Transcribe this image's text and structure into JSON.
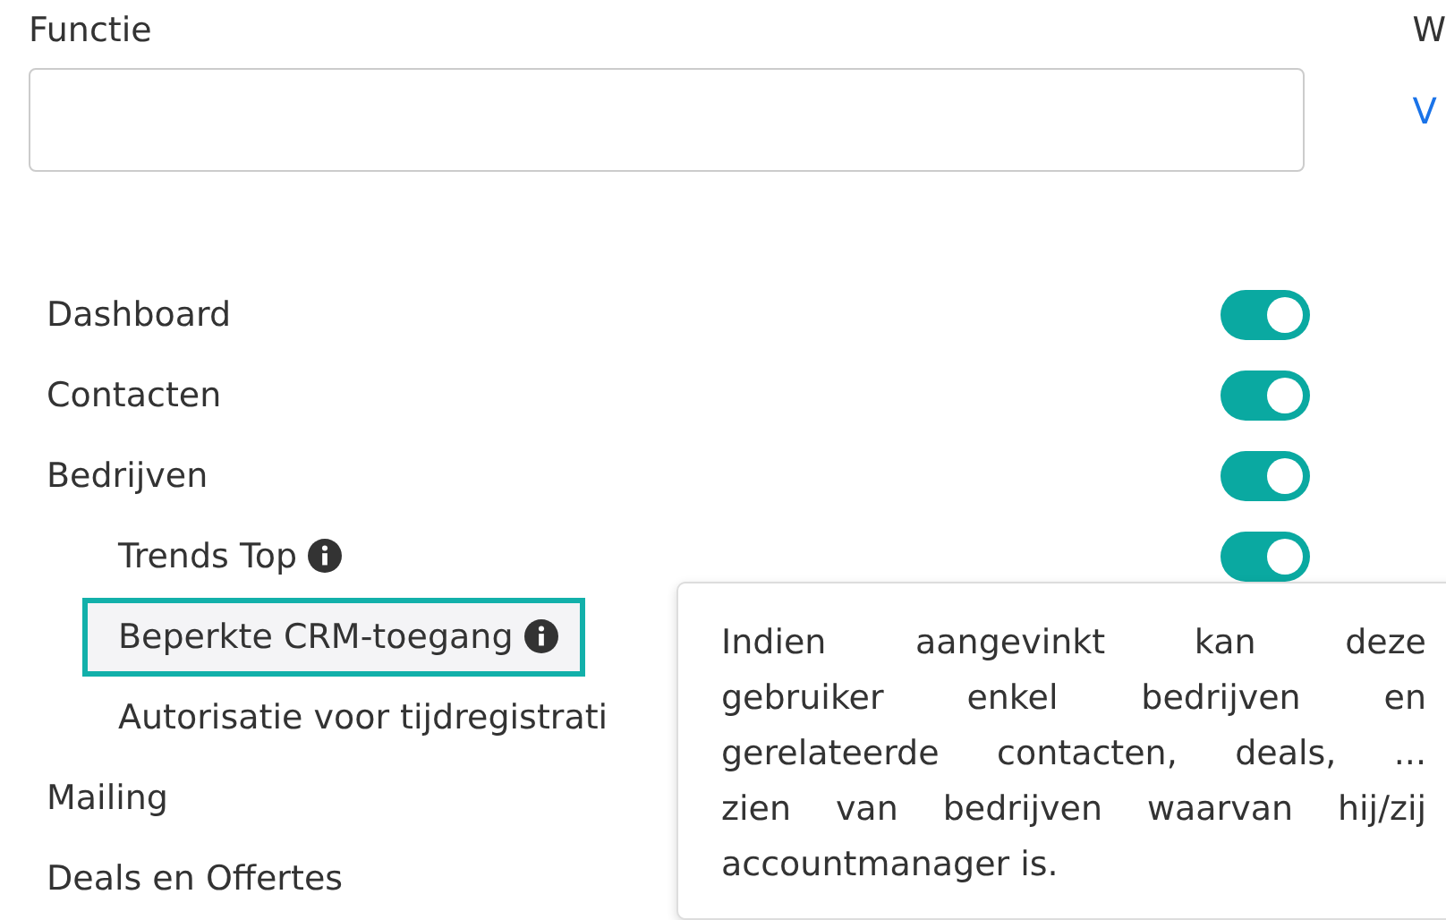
{
  "function_field": {
    "label": "Functie"
  },
  "side_field": {
    "label": "W",
    "link": "V"
  },
  "permissions": [
    {
      "label": "Dashboard",
      "on": true,
      "highlighted": false
    },
    {
      "label": "Contacten",
      "on": true,
      "highlighted": false
    },
    {
      "label": "Bedrijven",
      "on": true,
      "highlighted": false,
      "children": [
        {
          "label": "Trends Top",
          "info": true,
          "on": true,
          "highlighted": false
        },
        {
          "label": "Beperkte CRM-toegang",
          "info": true,
          "highlighted": true
        },
        {
          "label": "Autorisatie voor tijdregistrati",
          "highlighted": false
        }
      ]
    },
    {
      "label": "Mailing",
      "highlighted": false
    },
    {
      "label": "Deals en Offertes",
      "highlighted": false
    }
  ],
  "tooltip": {
    "lines": [
      "Indien aangevinkt kan deze",
      "gebruiker enkel bedrijven en",
      "gerelateerde contacten, deals, ...",
      "zien van bedrijven waarvan hij/zij",
      "accountmanager is."
    ]
  }
}
